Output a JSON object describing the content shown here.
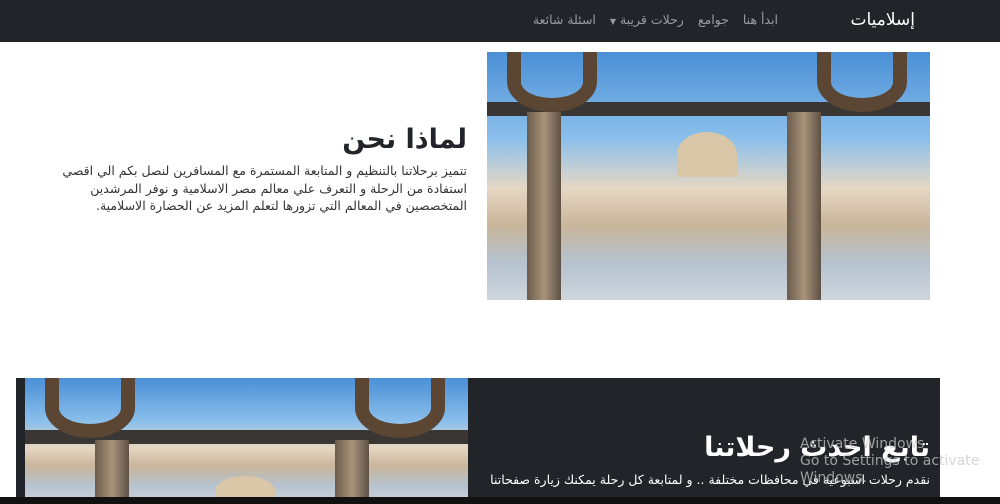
{
  "navbar": {
    "brand": "إسلاميات",
    "links": [
      "ابدأ هنا",
      "جوامع",
      "رحلات قريبة",
      "اسئلة شائعة"
    ]
  },
  "about": {
    "title": "لماذا نحن",
    "text": "تتميز برحلاتنا بالتنظيم و المتابعة المستمرة مع المسافرين لنصل بكم الي اقصي استفادة من الرحلة و التعرف علي معالم مصر الاسلامية و نوفر المرشدين المتخصصين في المعالم التي تزورها لتعلم المزيد عن الحضارة الاسلامية."
  },
  "trips": {
    "title": "تابع احدث رحلاتنا",
    "text": "نقدم رحلات اسبوعية في محافظات مختلفة .. و لمتابعة كل رحلة يمكنك زيارة صفحاتنا"
  },
  "watermark": {
    "line1": "Activate Windows",
    "line2": "Go to Settings to activate Windows."
  }
}
